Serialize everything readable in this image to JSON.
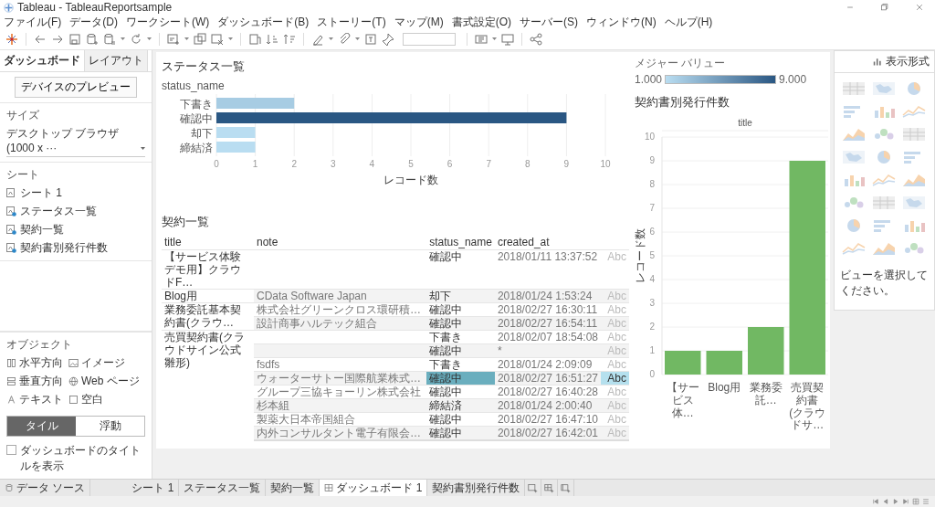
{
  "window": {
    "title": "Tableau - TableauReportsample"
  },
  "menu": [
    "ファイル(F)",
    "データ(D)",
    "ワークシート(W)",
    "ダッシュボード(B)",
    "ストーリー(T)",
    "マップ(M)",
    "書式設定(O)",
    "サーバー(S)",
    "ウィンドウ(N)",
    "ヘルプ(H)"
  ],
  "left_panel": {
    "tabs": [
      {
        "label": "ダッシュボード",
        "selected": true
      },
      {
        "label": "レイアウト",
        "selected": false
      }
    ],
    "preview_button": "デバイスのプレビュー",
    "size": {
      "label": "サイズ",
      "value": "デスクトップ ブラウザ (1000 x ···"
    },
    "sheets": {
      "label": "シート",
      "items": [
        {
          "name": "シート 1",
          "used": false
        },
        {
          "name": "ステータス一覧",
          "used": true
        },
        {
          "name": "契約一覧",
          "used": true
        },
        {
          "name": "契約書別発行件数",
          "used": true
        }
      ]
    },
    "objects": {
      "label": "オブジェクト",
      "items": [
        {
          "kind": "horizontal",
          "label": "水平方向"
        },
        {
          "kind": "image",
          "label": "イメージ"
        },
        {
          "kind": "vertical",
          "label": "垂直方向"
        },
        {
          "kind": "web",
          "label": "Web ページ"
        },
        {
          "kind": "text",
          "label": "テキスト"
        },
        {
          "kind": "blank",
          "label": "空白"
        }
      ]
    },
    "mode": [
      {
        "label": "タイル",
        "selected": true
      },
      {
        "label": "浮動",
        "selected": false
      }
    ],
    "show_title": {
      "label": "ダッシュボードのタイトルを表示",
      "checked": false
    }
  },
  "dashboard": {
    "status_chart": {
      "title": "ステータス一覧",
      "chart_data": {
        "type": "bar",
        "orientation": "horizontal",
        "ylabel": "status_name",
        "xlabel": "レコード数",
        "categories": [
          "下書き",
          "確認中",
          "却下",
          "締結済"
        ],
        "values": [
          2,
          9,
          1,
          1
        ],
        "xlim": [
          0,
          10
        ],
        "xticks": [
          0,
          1,
          2,
          3,
          4,
          5,
          6,
          7,
          8,
          9,
          10
        ],
        "grid": true
      }
    },
    "legend": {
      "title": "メジャー バリュー",
      "min": "1.000",
      "max": "9.000"
    },
    "contracts": {
      "title": "契約一覧",
      "columns": [
        "title",
        "note",
        "status_name",
        "created_at"
      ],
      "groups": [
        {
          "title": "【サービス体験デモ用】クラウドF…",
          "rows": [
            {
              "status_name": "確認中",
              "created_at": "2018/01/11 13:37:52",
              "value": "Abc",
              "selected": false
            }
          ]
        },
        {
          "title": "Blog用",
          "rows": [
            {
              "note": "CData Software Japan",
              "status_name": "却下",
              "created_at": "2018/01/24 1:53:24",
              "value": "Abc",
              "selected": false
            }
          ]
        },
        {
          "title": "業務委託基本契約書(クラウ…",
          "rows": [
            {
              "note": "株式会社グリーンクロス環研積…",
              "status_name": "確認中",
              "created_at": "2018/02/27 16:30:11",
              "value": "Abc",
              "selected": false
            },
            {
              "note": "設計商事ハルテック組合",
              "status_name": "確認中",
              "created_at": "2018/02/27 16:54:11",
              "value": "Abc",
              "selected": false
            }
          ]
        },
        {
          "title": "売買契約書(クラウドサイン公式雛形)",
          "rows": [
            {
              "status_name": "下書き",
              "created_at": "2018/02/07 18:54:08",
              "value": "Abc",
              "selected": false
            },
            {
              "status_name": "確認中",
              "created_at": "*",
              "value": "Abc",
              "selected": false
            },
            {
              "note": "fsdfs",
              "status_name": "下書き",
              "created_at": "2018/01/24 2:09:09",
              "value": "Abc",
              "selected": false
            },
            {
              "note": "ウォーターサトー国際航業株式…",
              "status_name": "確認中",
              "created_at": "2018/02/27 16:51:27",
              "value": "Abc",
              "selected": true
            },
            {
              "note": "グループ三協キョーリン株式会社",
              "status_name": "確認中",
              "created_at": "2018/02/27 16:40:28",
              "value": "Abc",
              "selected": false
            },
            {
              "note": "杉本組",
              "status_name": "締結済",
              "created_at": "2018/01/24 2:00:40",
              "value": "Abc",
              "selected": false
            },
            {
              "note": "製薬大日本帝国組合",
              "status_name": "確認中",
              "created_at": "2018/02/27 16:47:10",
              "value": "Abc",
              "selected": false
            },
            {
              "note": "内外コンサルタント電子有限会…",
              "status_name": "確認中",
              "created_at": "2018/02/27 16:42:01",
              "value": "Abc",
              "selected": false
            }
          ]
        }
      ]
    },
    "issue_chart": {
      "title": "契約書別発行件数",
      "chart_data": {
        "type": "bar",
        "xlabel": "title",
        "ylabel": "レコード数",
        "categories": [
          "【サービス体…",
          "Blog用",
          "業務委託…",
          "売買契約書\n(クラウドサ…"
        ],
        "series": [
          {
            "color": "#71b863",
            "values": [
              1,
              1,
              2,
              9
            ]
          }
        ],
        "ylim": [
          0,
          10
        ],
        "yticks": [
          0,
          1,
          2,
          3,
          4,
          5,
          6,
          7,
          8,
          9,
          10
        ],
        "grid": true
      }
    }
  },
  "show_me": {
    "title": "表示形式",
    "hint": "ビューを選択してください。"
  },
  "sheet_tabs": [
    {
      "kind": "datasource",
      "label": "データ ソース",
      "selected": false
    },
    {
      "kind": "sheet",
      "label": "シート 1",
      "selected": false
    },
    {
      "kind": "sheet",
      "label": "ステータス一覧",
      "selected": false
    },
    {
      "kind": "sheet",
      "label": "契約一覧",
      "selected": false
    },
    {
      "kind": "dashboard",
      "label": "ダッシュボード 1",
      "selected": true
    },
    {
      "kind": "sheet",
      "label": "契約書別発行件数",
      "selected": false
    }
  ]
}
